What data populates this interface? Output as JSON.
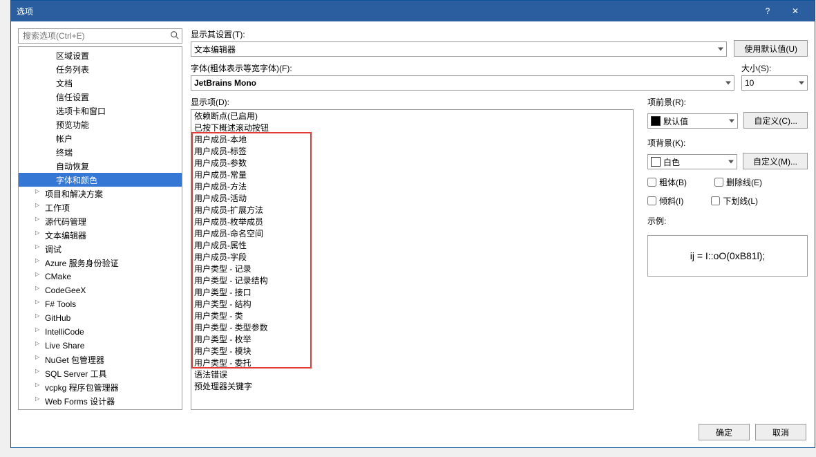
{
  "title": "选项",
  "search": {
    "placeholder": "搜索选项(Ctrl+E)"
  },
  "tree": {
    "items": [
      {
        "label": "区域设置",
        "indent": 1,
        "exp": ""
      },
      {
        "label": "任务列表",
        "indent": 1,
        "exp": ""
      },
      {
        "label": "文档",
        "indent": 1,
        "exp": ""
      },
      {
        "label": "信任设置",
        "indent": 1,
        "exp": ""
      },
      {
        "label": "选项卡和窗口",
        "indent": 1,
        "exp": ""
      },
      {
        "label": "预览功能",
        "indent": 1,
        "exp": ""
      },
      {
        "label": "帐户",
        "indent": 1,
        "exp": ""
      },
      {
        "label": "终端",
        "indent": 1,
        "exp": ""
      },
      {
        "label": "自动恢复",
        "indent": 1,
        "exp": ""
      },
      {
        "label": "字体和颜色",
        "indent": 1,
        "exp": "",
        "selected": true
      },
      {
        "label": "项目和解决方案",
        "indent": 0,
        "exp": "closed"
      },
      {
        "label": "工作项",
        "indent": 0,
        "exp": "closed"
      },
      {
        "label": "源代码管理",
        "indent": 0,
        "exp": "closed"
      },
      {
        "label": "文本编辑器",
        "indent": 0,
        "exp": "closed"
      },
      {
        "label": "调试",
        "indent": 0,
        "exp": "closed"
      },
      {
        "label": "Azure 服务身份验证",
        "indent": 0,
        "exp": "closed"
      },
      {
        "label": "CMake",
        "indent": 0,
        "exp": "closed"
      },
      {
        "label": "CodeGeeX",
        "indent": 0,
        "exp": "closed"
      },
      {
        "label": "F# Tools",
        "indent": 0,
        "exp": "closed"
      },
      {
        "label": "GitHub",
        "indent": 0,
        "exp": "closed"
      },
      {
        "label": "IntelliCode",
        "indent": 0,
        "exp": "closed"
      },
      {
        "label": "Live Share",
        "indent": 0,
        "exp": "closed"
      },
      {
        "label": "NuGet 包管理器",
        "indent": 0,
        "exp": "closed"
      },
      {
        "label": "SQL Server 工具",
        "indent": 0,
        "exp": "closed"
      },
      {
        "label": "vcpkg 程序包管理器",
        "indent": 0,
        "exp": "closed"
      },
      {
        "label": "Web Forms 设计器",
        "indent": 0,
        "exp": "closed"
      }
    ]
  },
  "show_settings": {
    "label": "显示其设置(T):",
    "value": "文本编辑器"
  },
  "use_defaults_btn": "使用默认值(U)",
  "font": {
    "label": "字体(粗体表示等宽字体)(F):",
    "value": "JetBrains Mono"
  },
  "size": {
    "label": "大小(S):",
    "value": "10"
  },
  "display_items": {
    "label": "显示项(D):",
    "items": [
      "依赖断点(已启用)",
      "已按下概述滚动按钮",
      "用户成员-本地",
      "用户成员-标签",
      "用户成员-参数",
      "用户成员-常量",
      "用户成员-方法",
      "用户成员-活动",
      "用户成员-扩展方法",
      "用户成员-枚举成员",
      "用户成员-命名空间",
      "用户成员-属性",
      "用户成员-字段",
      "用户类型 - 记录",
      "用户类型 - 记录结构",
      "用户类型 - 接口",
      "用户类型 - 结构",
      "用户类型 - 类",
      "用户类型 - 类型参数",
      "用户类型 - 枚举",
      "用户类型 - 模块",
      "用户类型 - 委托",
      "语法错误",
      "预处理器关键字"
    ]
  },
  "fg": {
    "label": "项前景(R):",
    "value": "默认值",
    "swatch": "#000000",
    "custom_btn": "自定义(C)..."
  },
  "bg": {
    "label": "项背景(K):",
    "value": "白色",
    "swatch": "#ffffff",
    "custom_btn": "自定义(M)..."
  },
  "checks": {
    "bold": "粗体(B)",
    "strike": "删除线(E)",
    "italic": "倾斜(I)",
    "underline": "下划线(L)"
  },
  "sample": {
    "label": "示例:",
    "text": "ij = I::oO(0xB81l);"
  },
  "footer": {
    "ok": "确定",
    "cancel": "取消"
  }
}
